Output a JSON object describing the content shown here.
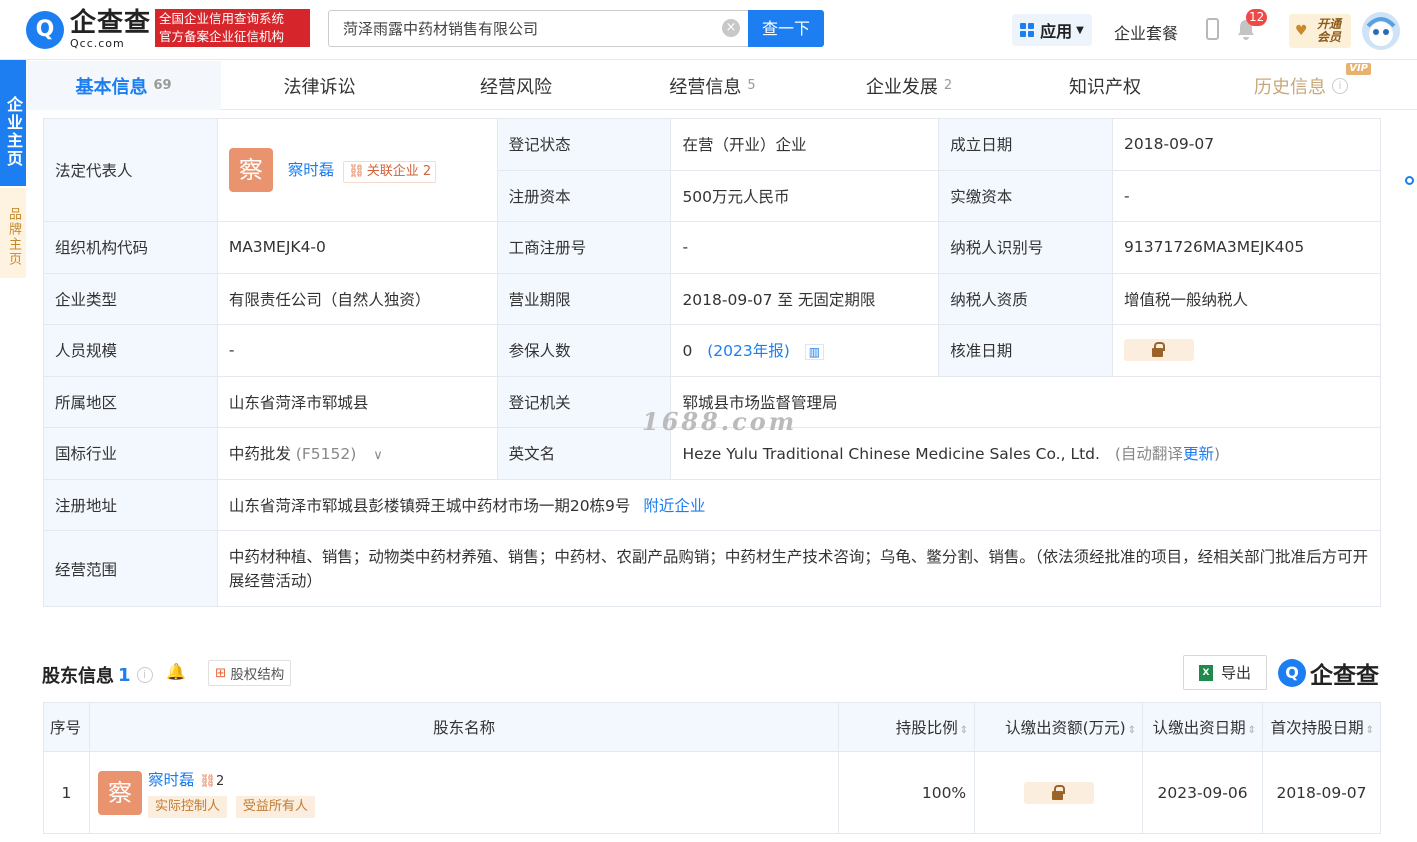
{
  "header": {
    "logo_cn": "企查查",
    "logo_en": "Qcc.com",
    "slogan_line1": "全国企业信用查询系统",
    "slogan_line2": "官方备案企业征信机构",
    "search_value": "菏泽雨露中药材销售有限公司",
    "search_button": "查一下",
    "apps_label": "应用",
    "suite_label": "企业套餐",
    "notification_count": "12",
    "vip_line1": "开通",
    "vip_line2": "会员"
  },
  "side": {
    "main_tab": "企业主页",
    "brand_tab": "品牌主页"
  },
  "tabs": [
    {
      "label": "基本信息",
      "count": "69"
    },
    {
      "label": "法律诉讼",
      "count": ""
    },
    {
      "label": "经营风险",
      "count": ""
    },
    {
      "label": "经营信息",
      "count": "5"
    },
    {
      "label": "企业发展",
      "count": "2"
    },
    {
      "label": "知识产权",
      "count": ""
    },
    {
      "label": "历史信息",
      "count": "",
      "vip_tag": "VIP"
    }
  ],
  "info": {
    "legal_rep_label": "法定代表人",
    "legal_rep_avatar": "察",
    "legal_rep_name": "察时磊",
    "related_label": "关联企业",
    "related_count": "2",
    "reg_status_label": "登记状态",
    "reg_status": "在营（开业）企业",
    "founded_label": "成立日期",
    "founded": "2018-09-07",
    "reg_capital_label": "注册资本",
    "reg_capital": "500万元人民币",
    "paid_capital_label": "实缴资本",
    "paid_capital": "-",
    "org_code_label": "组织机构代码",
    "org_code": "MA3MEJK4-0",
    "biz_reg_no_label": "工商注册号",
    "biz_reg_no": "-",
    "taxpayer_id_label": "纳税人识别号",
    "taxpayer_id": "91371726MA3MEJK405",
    "company_type_label": "企业类型",
    "company_type": "有限责任公司（自然人独资）",
    "biz_term_label": "营业期限",
    "biz_term": "2018-09-07 至 无固定期限",
    "taxpayer_qual_label": "纳税人资质",
    "taxpayer_qual": "增值税一般纳税人",
    "staff_size_label": "人员规模",
    "staff_size": "-",
    "insured_label": "参保人数",
    "insured": "0",
    "insured_year": "(2023年报)",
    "approval_date_label": "核准日期",
    "region_label": "所属地区",
    "region": "山东省菏泽市郓城县",
    "reg_authority_label": "登记机关",
    "reg_authority": "郓城县市场监督管理局",
    "industry_label": "国标行业",
    "industry": "中药批发",
    "industry_code": "(F5152)",
    "english_name_label": "英文名",
    "english_name": "Heze Yulu Traditional Chinese Medicine Sales Co., Ltd.",
    "auto_translate": "(自动翻译",
    "update_link": "更新",
    "close_paren": ")",
    "address_label": "注册地址",
    "address": "山东省菏泽市郓城县彭楼镇舜王城中药材市场一期20栋9号",
    "nearby_link": "附近企业",
    "scope_label": "经营范围",
    "scope": "中药材种植、销售；动物类中药材养殖、销售；中药材、农副产品购销；中药材生产技术咨询；乌龟、鳖分割、销售。（依法须经批准的项目，经相关部门批准后方可开展经营活动）"
  },
  "watermark": "1688.com",
  "shareholders": {
    "title": "股东信息",
    "count": "1",
    "equity_button": "股权结构",
    "export_button": "导出",
    "logo_text": "企查查",
    "columns": [
      "序号",
      "股东名称",
      "持股比例",
      "认缴出资额(万元)",
      "认缴出资日期",
      "首次持股日期"
    ],
    "rows": [
      {
        "index": "1",
        "avatar": "察",
        "name": "察时磊",
        "related_count": "2",
        "tag1": "实际控制人",
        "tag2": "受益所有人",
        "ratio": "100%",
        "subscribed_date": "2023-09-06",
        "first_hold_date": "2018-09-07"
      }
    ]
  }
}
